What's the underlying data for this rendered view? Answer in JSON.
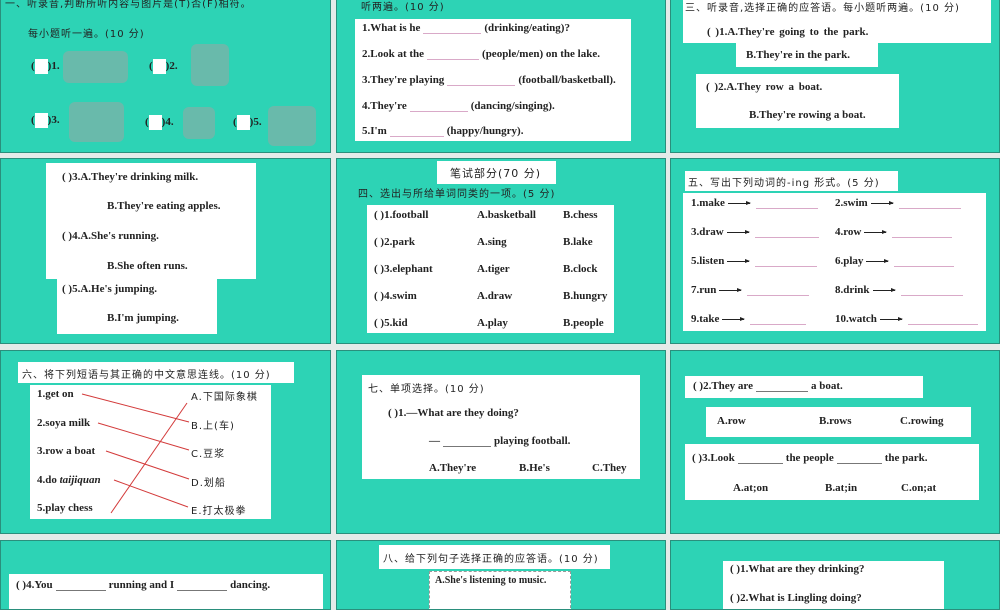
{
  "slide1": {
    "title": "一、听录音,判断所听内容与图片是(T)否(F)相符。",
    "subtitle": "每小题听一遍。(10 分)",
    "items": [
      "1.",
      "2.",
      "3.",
      "4.",
      "5."
    ]
  },
  "slide2": {
    "subtitle": "听两遍。(10 分)",
    "items": [
      {
        "pre": "1.What is he",
        "post": "(drinking/eating)?"
      },
      {
        "pre": "2.Look at the",
        "post": "(people/men) on the lake."
      },
      {
        "pre": "3.They're playing",
        "post": "(football/basketball)."
      },
      {
        "pre": "4.They're",
        "post": "(dancing/singing)."
      },
      {
        "pre": "5.I'm",
        "post": "(happy/hungry)."
      }
    ]
  },
  "slide3": {
    "title": "三、听录音,选择正确的应答语。每小题听两遍。(10 分)",
    "q1a": "( )1.A.They're going to the park.",
    "q1b": "B.They're in the park.",
    "q2a": "( )2.A.They row a boat.",
    "q2b": "B.They're rowing a boat."
  },
  "slide4": {
    "lines": [
      "( )3.A.They're drinking milk.",
      "B.They're eating apples.",
      "( )4.A.She's running.",
      "B.She often runs.",
      "( )5.A.He's jumping.",
      "B.I'm jumping."
    ]
  },
  "slide5": {
    "header": "笔试部分(70 分)",
    "title": "四、选出与所给单词同类的一项。(5 分)",
    "rows": [
      [
        "( )1.football",
        "A.basketball",
        "B.chess"
      ],
      [
        "( )2.park",
        "A.sing",
        "B.lake"
      ],
      [
        "( )3.elephant",
        "A.tiger",
        "B.clock"
      ],
      [
        "( )4.swim",
        "A.draw",
        "B.hungry"
      ],
      [
        "( )5.kid",
        "A.play",
        "B.people"
      ]
    ]
  },
  "slide6": {
    "title": "五、写出下列动词的-ing 形式。(5 分)",
    "words": [
      "1.make",
      "2.swim",
      "3.draw",
      "4.row",
      "5.listen",
      "6.play",
      "7.run",
      "8.drink",
      "9.take",
      "10.watch"
    ]
  },
  "slide7": {
    "title": "六、将下列短语与其正确的中文意思连线。(10 分)",
    "left": [
      "1.get on",
      "2.soya milk",
      "3.row a boat",
      "4.do ",
      "5.play chess"
    ],
    "italic": "taijiquan",
    "right": [
      "A.下国际象棋",
      "B.上(车)",
      "C.豆浆",
      "D.划船",
      "E.打太极拳"
    ]
  },
  "slide8": {
    "title": "七、单项选择。(10 分)",
    "q": "( )1.—What are they doing?",
    "dash": "—",
    "post": "playing football.",
    "options": [
      "A.They're",
      "B.He's",
      "C.They"
    ]
  },
  "slide9": {
    "q2_pre": "( )2.They are",
    "q2_post": "a boat.",
    "q2_options": [
      "A.row",
      "B.rows",
      "C.rowing"
    ],
    "q3_pre": "( )3.Look",
    "q3_mid": "the people",
    "q3_post": "the park.",
    "q3_options": [
      "A.at;on",
      "B.at;in",
      "C.on;at"
    ]
  },
  "slide10": {
    "pre": "( )4.You",
    "mid": "running and I",
    "post": "dancing."
  },
  "slide11": {
    "title": "八、给下列句子选择正确的应答语。(10 分)",
    "option": "A.She's listening to music."
  },
  "slide12": {
    "q1": "( )1.What are they drinking?",
    "q2": "( )2.What is Lingling doing?"
  },
  "colors": {
    "teal": "#2dd3b5",
    "gap": "#e4ebe9",
    "line": "#d33a3a"
  }
}
